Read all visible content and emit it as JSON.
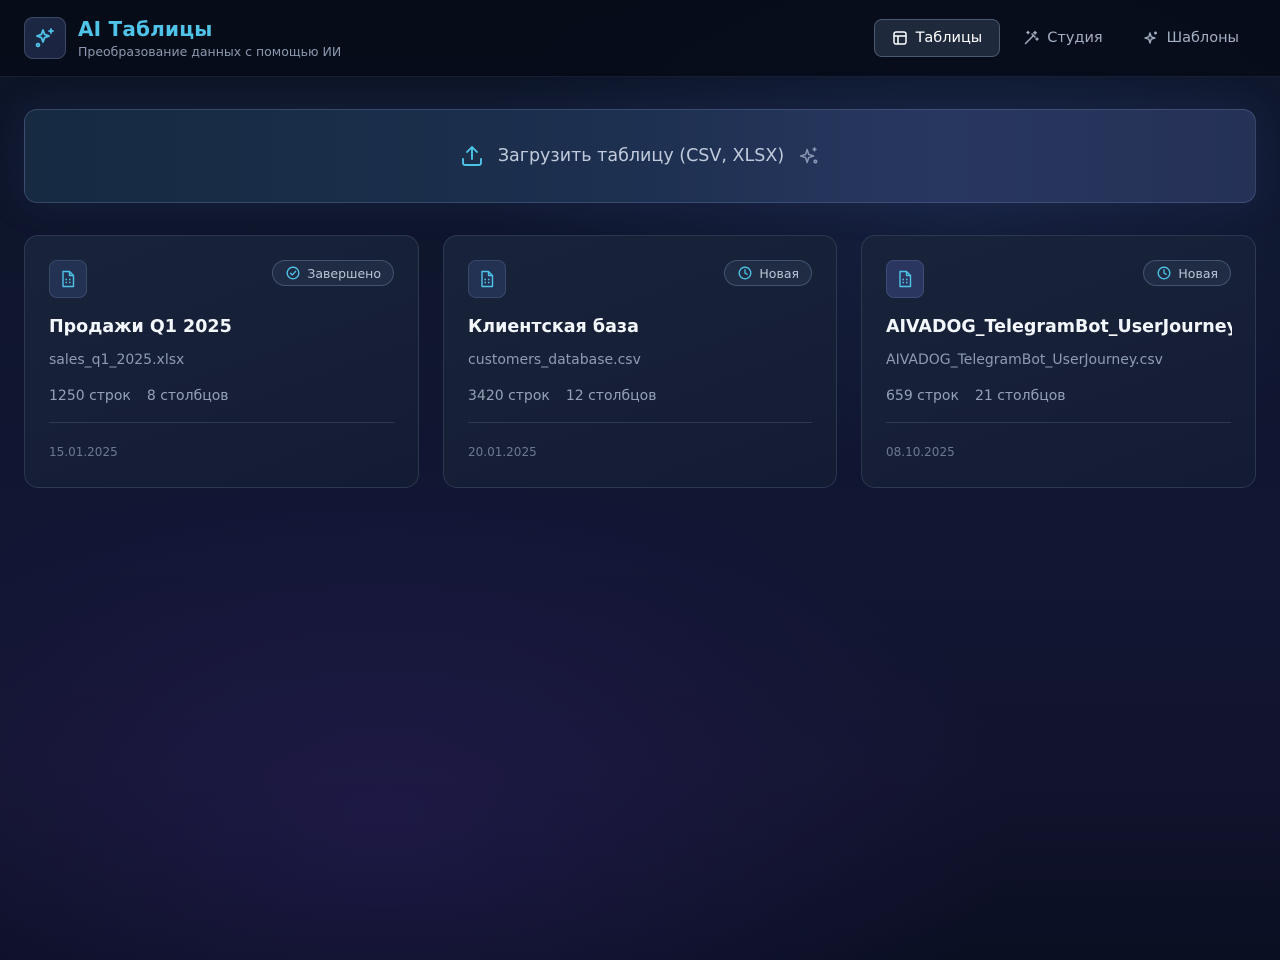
{
  "header": {
    "title": "AI Таблицы",
    "subtitle": "Преобразование данных с помощью ИИ",
    "logo_icon": "sparkles-icon",
    "accent_color": "#4fc3e8"
  },
  "nav": [
    {
      "label": "Таблицы",
      "icon": "table-icon",
      "active": true
    },
    {
      "label": "Студия",
      "icon": "magic-wand-icon",
      "active": false
    },
    {
      "label": "Шаблоны",
      "icon": "sparkles-icon",
      "active": false
    }
  ],
  "upload": {
    "label": "Загрузить таблицу (CSV, XLSX)",
    "icon": "upload-icon",
    "trailing_icon": "sparkles-icon"
  },
  "cards": [
    {
      "title": "Продажи Q1 2025",
      "file": "sales_q1_2025.xlsx",
      "rows": "1250 строк",
      "cols": "8 столбцов",
      "date": "15.01.2025",
      "status": "Завершено",
      "status_icon": "check-circle-icon"
    },
    {
      "title": "Клиентская база",
      "file": "customers_database.csv",
      "rows": "3420 строк",
      "cols": "12 столбцов",
      "date": "20.01.2025",
      "status": "Новая",
      "status_icon": "clock-icon"
    },
    {
      "title": "AIVADOG_TelegramBot_UserJourney",
      "file": "AIVADOG_TelegramBot_UserJourney.csv",
      "rows": "659 строк",
      "cols": "21 столбцов",
      "date": "08.10.2025",
      "status": "Новая",
      "status_icon": "clock-icon"
    }
  ]
}
